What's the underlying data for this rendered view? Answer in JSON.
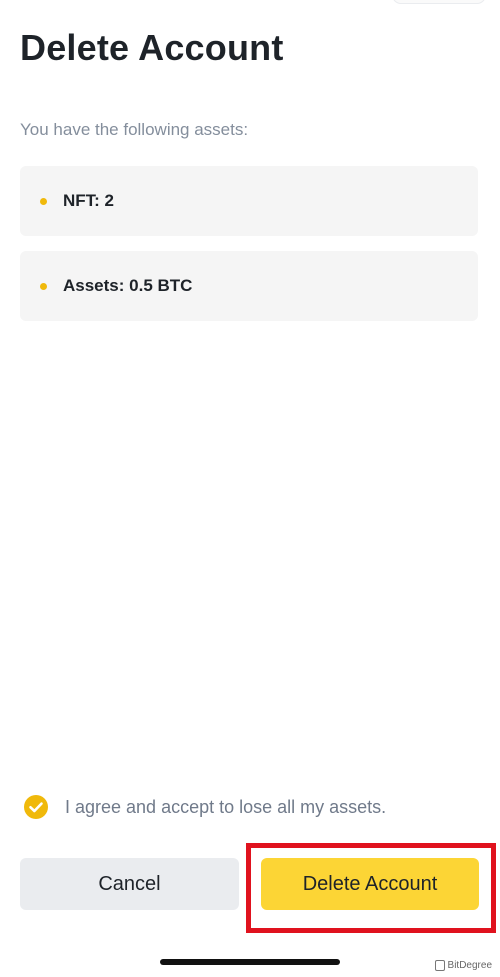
{
  "page": {
    "title": "Delete Account",
    "subtitle": "You have the following assets:"
  },
  "assets": [
    {
      "label": "NFT: 2"
    },
    {
      "label": "Assets: 0.5 BTC"
    }
  ],
  "agreement": {
    "text": "I agree and accept to lose all my assets.",
    "checked": true,
    "icon": "check-circle-icon"
  },
  "buttons": {
    "cancel_label": "Cancel",
    "delete_label": "Delete Account"
  },
  "watermark": {
    "text": "BitDegree"
  },
  "colors": {
    "accent": "#fcd535",
    "bullet": "#f0b90b",
    "highlight": "#e0121e"
  }
}
